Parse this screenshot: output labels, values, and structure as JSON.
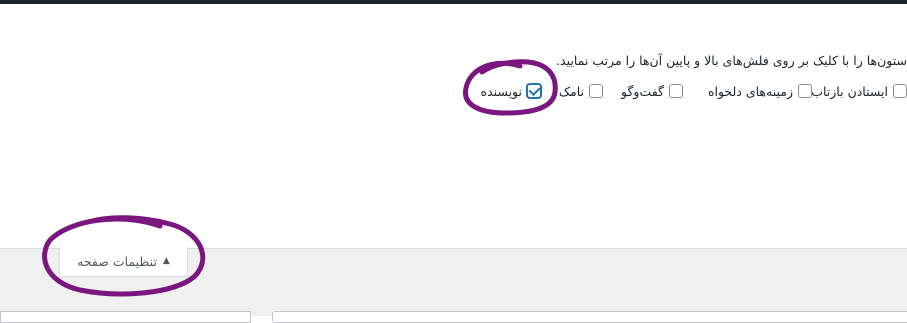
{
  "screen_options": {
    "help_text": "ستون‌ها را با کلیک بر روی فلش‌های بالا و پایین آن‌ها را مرتب نمایید.",
    "columns": [
      {
        "label": "ایستادن بازتاب‌ها",
        "checked": false
      },
      {
        "label": "زمینه‌های دلخواه",
        "checked": false
      },
      {
        "label": "گفت‌وگو",
        "checked": false
      },
      {
        "label": "نامک",
        "checked": false
      },
      {
        "label": "نویسنده",
        "checked": true
      }
    ]
  },
  "footer": {
    "screen_options_button": "تنظیمات صفحه",
    "toggle_icon": "triangle-up-icon"
  },
  "colors": {
    "annotation": "#7b1580",
    "checkbox_accent": "#2271b1"
  }
}
